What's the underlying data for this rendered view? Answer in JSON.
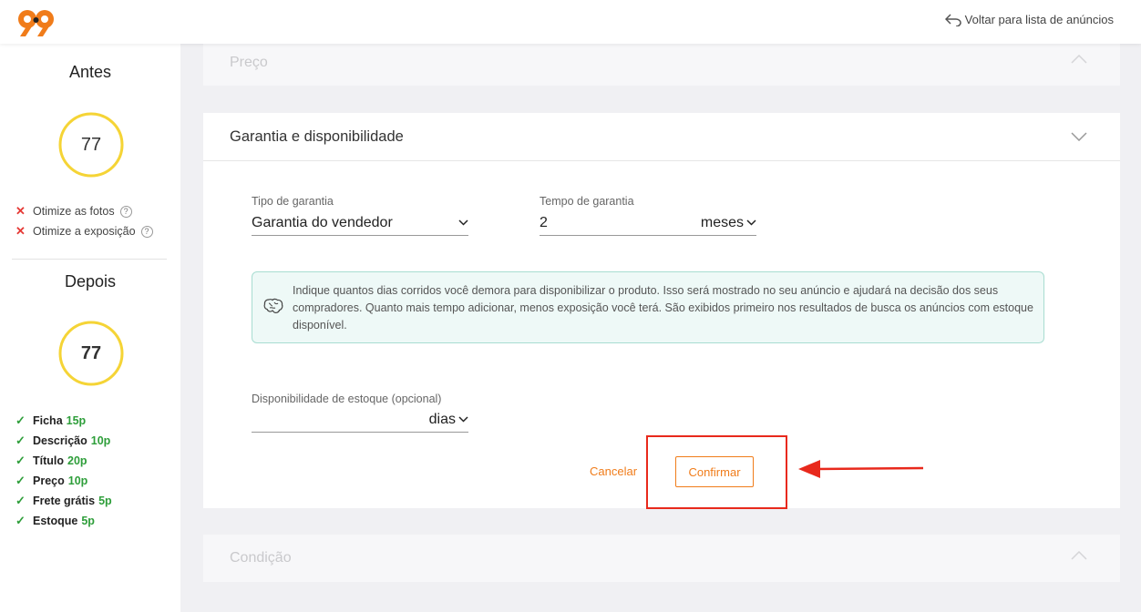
{
  "topbar": {
    "back_label": "Voltar para lista de anúncios"
  },
  "sidebar": {
    "before_title": "Antes",
    "before_score": "77",
    "tips": [
      {
        "label": "Otimize as fotos"
      },
      {
        "label": "Otimize a exposição"
      }
    ],
    "after_title": "Depois",
    "after_score": "77",
    "score_items": [
      {
        "label": "Ficha",
        "points": "15p"
      },
      {
        "label": "Descrição",
        "points": "10p"
      },
      {
        "label": "Título",
        "points": "20p"
      },
      {
        "label": "Preço",
        "points": "10p"
      },
      {
        "label": "Frete grátis",
        "points": "5p"
      },
      {
        "label": "Estoque",
        "points": "5p"
      }
    ]
  },
  "sections": {
    "price_title": "Preço",
    "condition_title": "Condição"
  },
  "warranty": {
    "title": "Garantia e disponibilidade",
    "type_label": "Tipo de garantia",
    "type_value": "Garantia do vendedor",
    "time_label": "Tempo de garantia",
    "time_value": "2",
    "time_unit": "meses",
    "info_text": "Indique quantos dias corridos você demora para disponibilizar o produto. Isso será mostrado no seu anúncio e ajudará na decisão dos seus compradores. Quanto mais tempo adicionar, menos exposição você terá. São exibidos primeiro nos resultados de busca os anúncios com estoque disponível.",
    "stock_label": "Disponibilidade de estoque (opcional)",
    "stock_value": "",
    "stock_unit": "dias",
    "cancel_label": "Cancelar",
    "confirm_label": "Confirmar"
  },
  "colors": {
    "accent": "#f07c1a",
    "ring": "#f5d436",
    "success": "#2e9e3a",
    "error": "#e53935",
    "annotation": "#e8291c"
  }
}
